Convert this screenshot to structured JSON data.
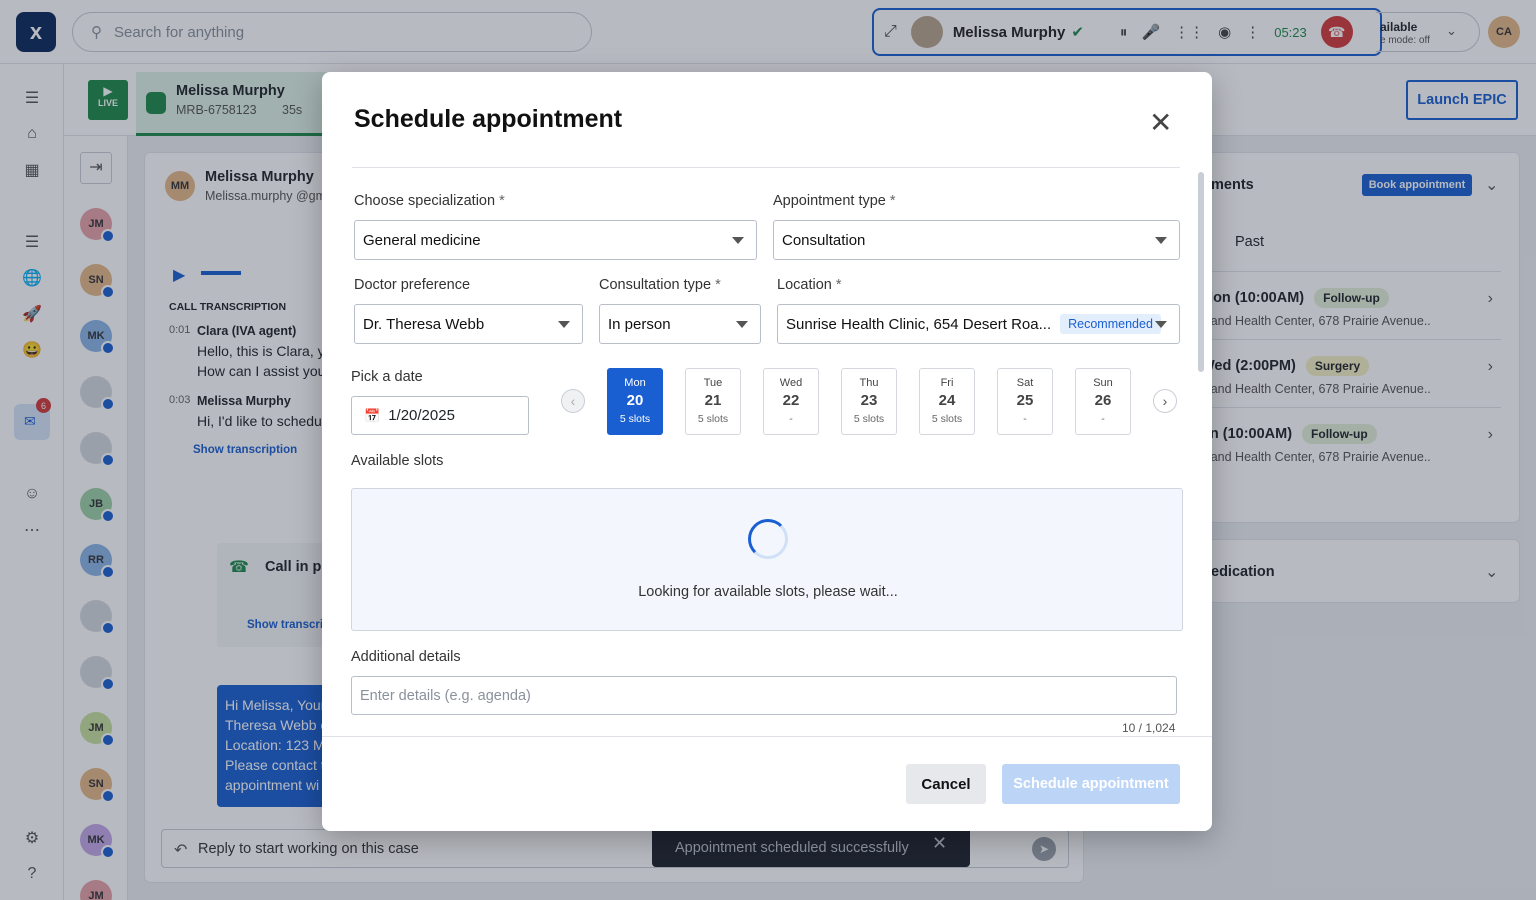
{
  "search": {
    "placeholder": "Search for anything"
  },
  "call": {
    "name": "Melissa Murphy",
    "timer": "05:23",
    "status": "ailable",
    "mode": "e mode: off",
    "user_initials": "CA"
  },
  "tab": {
    "live": "LIVE",
    "name": "Melissa Murphy",
    "id": "MRB-6758123",
    "time": "35s"
  },
  "launch": "Launch EPIC",
  "queue": [
    {
      "i": "JM",
      "c": "#e7a3a8"
    },
    {
      "i": "SN",
      "c": "#e6b98a"
    },
    {
      "i": "MK",
      "c": "#8bb5e8"
    },
    {
      "i": "",
      "c": "#d5d9df"
    },
    {
      "i": "",
      "c": "#d5d9df"
    },
    {
      "i": "JB",
      "c": "#9fd2a8"
    },
    {
      "i": "RR",
      "c": "#8bb5e8"
    },
    {
      "i": "",
      "c": "#d5d9df"
    },
    {
      "i": "",
      "c": "#d5d9df"
    },
    {
      "i": "JM",
      "c": "#c7e0a0"
    },
    {
      "i": "SN",
      "c": "#e6b98a"
    },
    {
      "i": "MK",
      "c": "#c4a8e8"
    },
    {
      "i": "JM",
      "c": "#e7a3a8"
    }
  ],
  "inbox_badge": "6",
  "conv": {
    "avatar": "MM",
    "name": "Melissa Murphy",
    "email": "Melissa.murphy @gma",
    "call_trans": "CALL TRANSCRIPTION",
    "t1": "0:01",
    "s1": "Clara (IVA agent)",
    "m1a": "Hello, this is Clara, y",
    "m1b": "How can I assist you",
    "t2": "0:03",
    "s2": "Melissa Murphy",
    "m2": "Hi, I'd like to schedu",
    "show": "Show transcription",
    "callin": "Call in pr",
    "show2": "Show transcrip",
    "msg": [
      "Hi Melissa, Your",
      "Theresa Webb c",
      "Location: 123 M",
      "Please contact t",
      "appointment wi"
    ],
    "reply": "Reply to start working on this case"
  },
  "right": {
    "title": "ments",
    "book": "Book appointment",
    "past": "Past",
    "appts": [
      {
        "when": "Mon (10:00AM)",
        "tag": "Follow-up",
        "loc": "dland Health Center, 678 Prairie Avenue.."
      },
      {
        "when": "Wed (2:00PM)",
        "tag": "Surgery",
        "loc": "dland Health Center, 678 Prairie Avenue.."
      },
      {
        "when": "on (10:00AM)",
        "tag": "Follow-up",
        "loc": "dland Health Center, 678 Prairie Avenue.."
      }
    ],
    "med": "edication"
  },
  "modal": {
    "title": "Schedule appointment",
    "spec_label": "Choose specialization",
    "spec": "General medicine",
    "appt_label": "Appointment type",
    "appt": "Consultation",
    "doc_label": "Doctor preference",
    "doc": "Dr. Theresa Webb",
    "cons_label": "Consultation type",
    "cons": "In person",
    "loc_label": "Location",
    "loc": "Sunrise Health Clinic, 654 Desert Roa...",
    "reco": "Recommended",
    "date_label": "Pick a date",
    "date": "1/20/2025",
    "days": [
      {
        "n": "Mon",
        "d": "20",
        "s": "5 slots"
      },
      {
        "n": "Tue",
        "d": "21",
        "s": "5 slots"
      },
      {
        "n": "Wed",
        "d": "22",
        "s": "-"
      },
      {
        "n": "Thu",
        "d": "23",
        "s": "5 slots"
      },
      {
        "n": "Fri",
        "d": "24",
        "s": "5 slots"
      },
      {
        "n": "Sat",
        "d": "25",
        "s": "-"
      },
      {
        "n": "Sun",
        "d": "26",
        "s": "-"
      }
    ],
    "slots_label": "Available slots",
    "loading": "Looking for available slots, please wait...",
    "details_label": "Additional details",
    "details_ph": "Enter details (e.g. agenda)",
    "counter": "10 / 1,024",
    "cancel": "Cancel",
    "submit": "Schedule appointment"
  },
  "toast": "Appointment scheduled successfully"
}
